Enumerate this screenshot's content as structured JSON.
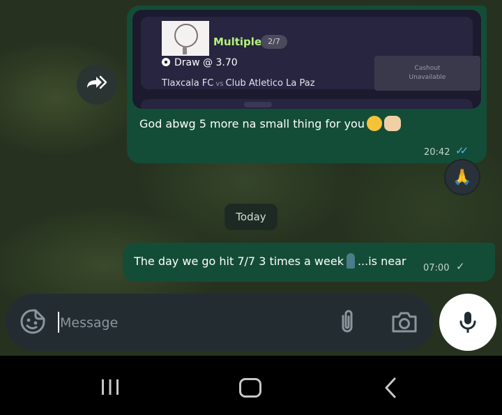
{
  "messages": [
    {
      "preview": {
        "bet_type": "Multiple",
        "badge": "2/7",
        "selection": "Draw @ 3.70",
        "home_team": "Tlaxcala FC",
        "vs": "vs",
        "away_team": "Club Atletico La Paz",
        "cashout_line1": "Cashout",
        "cashout_line2": "Unavailable"
      },
      "text": "God abwg 5 more na small thing for you",
      "time": "20:42",
      "status": "read",
      "reaction": "🙏"
    },
    {
      "text_before": "The day we go hit 7/7 3 times a week",
      "text_after": "...is near",
      "time": "07:00",
      "status": "sent"
    }
  ],
  "date_divider": "Today",
  "composer": {
    "placeholder": "Message"
  },
  "icons": {
    "forward": "forward-icon",
    "emoji": "sticker-icon",
    "attach": "paperclip-icon",
    "camera": "camera-icon",
    "mic": "mic-icon"
  },
  "colors": {
    "outgoing_bubble": "#144d37",
    "read_ticks": "#53bdeb",
    "accent_green": "#b6f27a"
  }
}
